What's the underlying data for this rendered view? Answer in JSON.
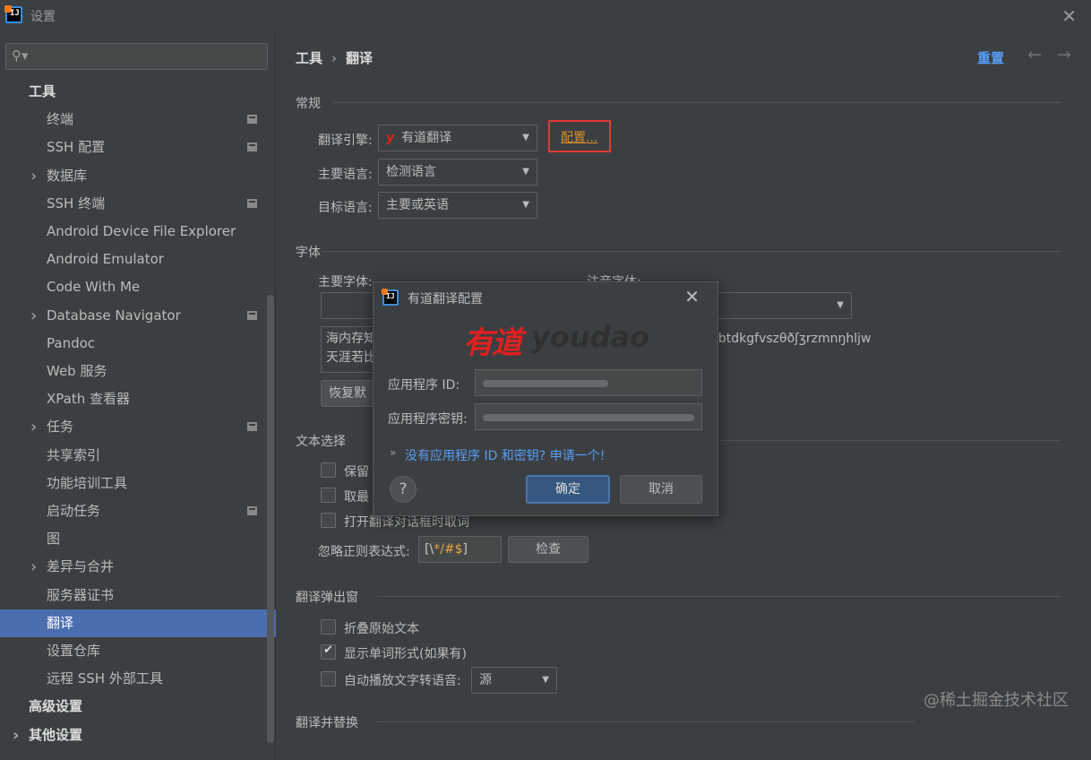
{
  "window": {
    "title": "设置"
  },
  "sidebar": {
    "items": [
      {
        "label": "工具",
        "level": 0,
        "root": true
      },
      {
        "label": "终端",
        "level": 1,
        "badge": true
      },
      {
        "label": "SSH 配置",
        "level": 1,
        "badge": true
      },
      {
        "label": "数据库",
        "level": 1,
        "expandable": true
      },
      {
        "label": "SSH 终端",
        "level": 1,
        "badge": true
      },
      {
        "label": "Android Device File Explorer",
        "level": 1
      },
      {
        "label": "Android Emulator",
        "level": 1
      },
      {
        "label": "Code With Me",
        "level": 1
      },
      {
        "label": "Database Navigator",
        "level": 1,
        "expandable": true,
        "badge": true
      },
      {
        "label": "Pandoc",
        "level": 1
      },
      {
        "label": "Web 服务",
        "level": 1
      },
      {
        "label": "XPath 查看器",
        "level": 1
      },
      {
        "label": "任务",
        "level": 1,
        "expandable": true,
        "badge": true
      },
      {
        "label": "共享索引",
        "level": 1
      },
      {
        "label": "功能培训工具",
        "level": 1
      },
      {
        "label": "启动任务",
        "level": 1,
        "badge": true
      },
      {
        "label": "图",
        "level": 1
      },
      {
        "label": "差异与合并",
        "level": 1,
        "expandable": true
      },
      {
        "label": "服务器证书",
        "level": 1
      },
      {
        "label": "翻译",
        "level": 1,
        "selected": true
      },
      {
        "label": "设置仓库",
        "level": 1
      },
      {
        "label": "远程 SSH 外部工具",
        "level": 1
      },
      {
        "label": "高级设置",
        "level": 0,
        "root": true
      },
      {
        "label": "其他设置",
        "level": 0,
        "root": true,
        "expandable": true
      }
    ]
  },
  "header": {
    "breadcrumb_parent": "工具",
    "breadcrumb_sep": "›",
    "breadcrumb_current": "翻译",
    "reset_label": "重置",
    "back_icon": "←",
    "forward_icon": "→"
  },
  "general": {
    "section_title": "常规",
    "engine_label": "翻译引擎:",
    "engine_icon": "y",
    "engine_value": "有道翻译",
    "config_link": "配置...",
    "primary_lang_label": "主要语言:",
    "primary_lang_value": "检测语言",
    "target_lang_label": "目标语言:",
    "target_lang_value": "主要或英语"
  },
  "font": {
    "section_title": "字体",
    "primary_font_label": "主要字体:",
    "phonetic_font_label": "注音字体:",
    "preview_line1": "海内存知",
    "preview_line2": "天涯若比",
    "phonetic_preview": "bbtdkgfvszθðʃʒrzmnŋhljw",
    "restore_button": "恢复默"
  },
  "text_selection": {
    "section_title": "文本选择",
    "options": [
      {
        "label": "保留",
        "checked": false
      },
      {
        "label": "取最",
        "checked": false
      },
      {
        "label": "打开翻译对话框时取词",
        "checked": false
      }
    ],
    "regex_label": "忽略正则表达式:",
    "regex_prefix": "[\\",
    "regex_accent": "*/#$",
    "regex_suffix": "]",
    "check_button": "检查"
  },
  "popup": {
    "section_title": "翻译弹出窗",
    "options": [
      {
        "label": "折叠原始文本",
        "checked": false
      },
      {
        "label": "显示单词形式(如果有)",
        "checked": true
      },
      {
        "label": "自动播放文字转语音:",
        "checked": false
      }
    ],
    "tts_value": "源"
  },
  "replace": {
    "section_title": "翻译并替换"
  },
  "dialog": {
    "title": "有道翻译配置",
    "logo_cn": "有道",
    "logo_en": "youdao",
    "app_id_label": "应用程序 ID:",
    "app_secret_label": "应用程序密钥:",
    "link_arrow": "»",
    "link_text": "没有应用程序 ID 和密钥? 申请一个!",
    "help_label": "?",
    "ok_label": "确定",
    "cancel_label": "取消"
  },
  "watermark": "@稀土掘金技术社区"
}
